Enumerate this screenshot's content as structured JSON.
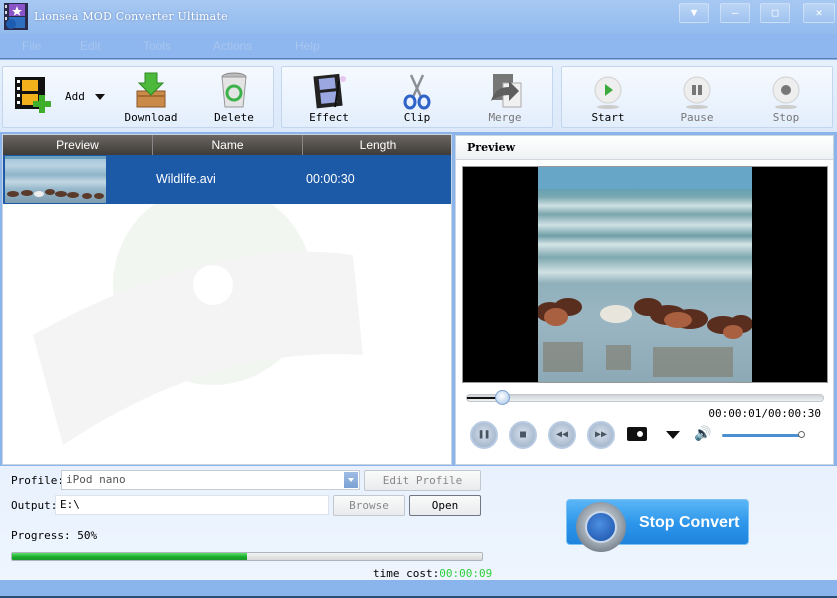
{
  "window": {
    "title": "Lionsea MOD Converter Ultimate",
    "controls": [
      "menu",
      "minimize",
      "maximize",
      "close"
    ]
  },
  "menu": [
    "File",
    "Edit",
    "Tools",
    "Actions",
    "Help"
  ],
  "toolbar": {
    "add_label": "Add",
    "download_label": "Download",
    "delete_label": "Delete",
    "effect_label": "Effect",
    "clip_label": "Clip",
    "merge_label": "Merge",
    "start_label": "Start",
    "pause_label": "Pause",
    "stop_label": "Stop"
  },
  "filelist": {
    "columns": [
      "Preview",
      "Name",
      "Length"
    ],
    "rows": [
      {
        "name": "Wildlife.avi",
        "length": "00:00:30",
        "selected": true
      }
    ]
  },
  "preview": {
    "title": "Preview",
    "timecode": "00:00:01/00:00:30",
    "seek_fraction": 0.033,
    "volume_fraction": 1.0
  },
  "settings": {
    "profile_label": "Profile:",
    "profile_value": "iPod nano",
    "edit_profile_label": "Edit Profile",
    "output_label": "Output:",
    "output_value": "E:\\",
    "browse_label": "Browse",
    "open_label": "Open"
  },
  "progress": {
    "label": "Progress: 50%",
    "percent": 50,
    "time_cost_label": "time cost:",
    "time_cost_value": "00:00:09"
  },
  "actions": {
    "stop_convert_label": "Stop Convert"
  },
  "colors": {
    "accent": "#1c5aa8",
    "progress": "#16a82a",
    "time_cost": "#2fcf3e",
    "stop_convert": "#2c95ea"
  }
}
